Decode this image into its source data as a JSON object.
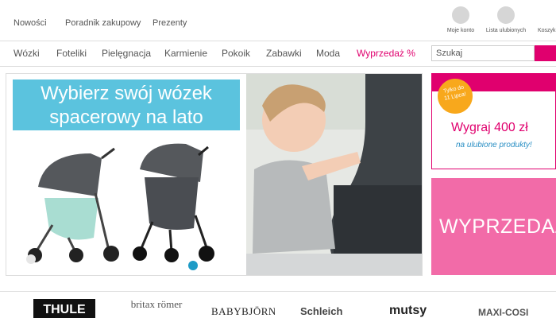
{
  "top_nav": {
    "links": [
      "Nowości",
      "Poradnik zakupowy",
      "Prezenty"
    ]
  },
  "account": {
    "my_account": "Moje konto",
    "wishlist": "Lista ulubionych",
    "cart": "Koszyk"
  },
  "categories": [
    "Wózki",
    "Foteliki",
    "Pielęgnacja",
    "Karmienie",
    "Pokoik",
    "Zabawki",
    "Moda",
    "Wyprzedaż %"
  ],
  "search": {
    "placeholder": "Szukaj"
  },
  "hero": {
    "headline_line1": "Wybierz swój wózek",
    "headline_line2": "spacerowy na lato",
    "carousel": {
      "active_slide": 2,
      "slide_count": 2
    }
  },
  "promo": {
    "badge_line1": "Tylko do",
    "badge_line2": "11 Lipca!",
    "title": "Wygraj 400 zł",
    "subtitle": "na ulubione produkty!",
    "sale_text": "WYPRZEDAŻ"
  },
  "brands": [
    "THULE",
    "britax römer",
    "BABYBJÖRN",
    "Schleich",
    "mutsy",
    "MAXI-COSI"
  ],
  "colors": {
    "accent_pink": "#e0006e",
    "banner_blue": "#5bc3de",
    "sale_pink": "#f26ba8",
    "badge_orange": "#f8a81c",
    "dot_active": "#1e9bc6"
  }
}
